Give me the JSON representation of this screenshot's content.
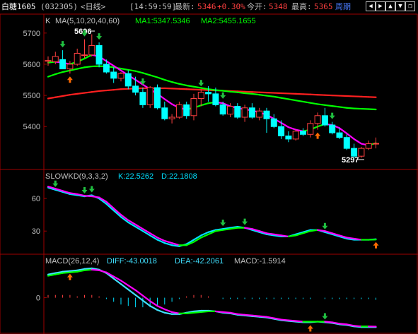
{
  "toolbar": {
    "symbol": "白糖1605",
    "code": "(032305)",
    "period": "<日线>",
    "time": "[14:59:59]",
    "latest_label": "最新:",
    "latest_value": "5346",
    "change": "+0.30%",
    "open_label": "今开:",
    "open_value": "5348",
    "high_label": "最高:",
    "high_value": "5365",
    "cycle_label": "周期",
    "nav_icons": [
      "arrow-left-icon",
      "arrow-right-icon",
      "arrow-up-icon",
      "arrow-down-icon",
      "restore-icon"
    ]
  },
  "chart_data": [
    {
      "type": "candlestick",
      "header": {
        "name": "K",
        "ma_spec": "MA(5,10,20,40,60)",
        "ma1": "MA1:5347.5346",
        "ma2": "MA2:5455.1655"
      },
      "yticks": [
        5700,
        5600,
        5500,
        5400
      ],
      "ylim": [
        5285,
        5720
      ],
      "annotations": {
        "high": "5696",
        "low": "5297"
      },
      "candles": [
        [
          5610,
          5625,
          5595,
          5612
        ],
        [
          5608,
          5640,
          5600,
          5625
        ],
        [
          5615,
          5645,
          5592,
          5585
        ],
        [
          5585,
          5610,
          5570,
          5600
        ],
        [
          5600,
          5650,
          5595,
          5635
        ],
        [
          5630,
          5680,
          5620,
          5630
        ],
        [
          5630,
          5696,
          5625,
          5660
        ],
        [
          5660,
          5670,
          5590,
          5600
        ],
        [
          5600,
          5615,
          5570,
          5575
        ],
        [
          5575,
          5590,
          5540,
          5555
        ],
        [
          5555,
          5575,
          5545,
          5570
        ],
        [
          5570,
          5580,
          5520,
          5530
        ],
        [
          5530,
          5560,
          5500,
          5510
        ],
        [
          5510,
          5525,
          5460,
          5470
        ],
        [
          5470,
          5530,
          5460,
          5525
        ],
        [
          5525,
          5535,
          5455,
          5460
        ],
        [
          5460,
          5480,
          5420,
          5425
        ],
        [
          5425,
          5440,
          5410,
          5430
        ],
        [
          5430,
          5480,
          5425,
          5470
        ],
        [
          5470,
          5480,
          5425,
          5435
        ],
        [
          5435,
          5505,
          5420,
          5490
        ],
        [
          5490,
          5520,
          5465,
          5510
        ],
        [
          5510,
          5530,
          5480,
          5505
        ],
        [
          5505,
          5525,
          5465,
          5470
        ],
        [
          5470,
          5480,
          5435,
          5440
        ],
        [
          5440,
          5475,
          5430,
          5465
        ],
        [
          5465,
          5475,
          5425,
          5430
        ],
        [
          5430,
          5470,
          5415,
          5460
        ],
        [
          5460,
          5475,
          5425,
          5430
        ],
        [
          5430,
          5460,
          5420,
          5450
        ],
        [
          5450,
          5460,
          5380,
          5425
        ],
        [
          5425,
          5440,
          5395,
          5400
        ],
        [
          5400,
          5420,
          5360,
          5370
        ],
        [
          5370,
          5385,
          5350,
          5360
        ],
        [
          5360,
          5390,
          5355,
          5385
        ],
        [
          5385,
          5395,
          5370,
          5375
        ],
        [
          5375,
          5420,
          5365,
          5410
        ],
        [
          5410,
          5445,
          5390,
          5435
        ],
        [
          5435,
          5460,
          5400,
          5405
        ],
        [
          5405,
          5415,
          5375,
          5380
        ],
        [
          5380,
          5395,
          5360,
          5365
        ],
        [
          5365,
          5375,
          5325,
          5330
        ],
        [
          5330,
          5345,
          5297,
          5305
        ],
        [
          5305,
          5335,
          5300,
          5330
        ],
        [
          5330,
          5355,
          5325,
          5345
        ],
        [
          5345,
          5365,
          5330,
          5346
        ]
      ],
      "ma_lines": [
        {
          "name": "MA1",
          "color": "#00ff00",
          "alt_color": "#ff00ff",
          "values": [
            5605,
            5608,
            5605,
            5600,
            5608,
            5618,
            5630,
            5625,
            5610,
            5595,
            5580,
            5565,
            5550,
            5535,
            5520,
            5505,
            5488,
            5472,
            5460,
            5455,
            5460,
            5468,
            5475,
            5478,
            5475,
            5465,
            5460,
            5455,
            5452,
            5445,
            5438,
            5425,
            5412,
            5398,
            5390,
            5385,
            5390,
            5400,
            5408,
            5405,
            5395,
            5378,
            5360,
            5345,
            5340,
            5347
          ]
        },
        {
          "name": "MA2",
          "color": "#00ff00",
          "values": [
            5560,
            5568,
            5575,
            5580,
            5585,
            5590,
            5593,
            5594,
            5593,
            5590,
            5586,
            5582,
            5578,
            5572,
            5565,
            5558,
            5550,
            5543,
            5537,
            5532,
            5528,
            5524,
            5520,
            5517,
            5515,
            5512,
            5510,
            5507,
            5505,
            5502,
            5499,
            5496,
            5492,
            5488,
            5484,
            5480,
            5476,
            5472,
            5469,
            5466,
            5463,
            5460,
            5458,
            5457,
            5456,
            5455
          ]
        },
        {
          "name": "MA-long",
          "color": "#ff2020",
          "values": [
            5490,
            5494,
            5498,
            5502,
            5505,
            5508,
            5511,
            5514,
            5516,
            5518,
            5520,
            5521,
            5522,
            5523,
            5523,
            5523,
            5523,
            5522,
            5521,
            5520,
            5519,
            5518,
            5517,
            5516,
            5515,
            5514,
            5513,
            5512,
            5511,
            5510,
            5509,
            5508,
            5507,
            5506,
            5505,
            5504,
            5503,
            5502,
            5501,
            5500,
            5499,
            5498,
            5497,
            5496,
            5495,
            5494
          ]
        }
      ],
      "signals": [
        {
          "index": 2,
          "dir": "down"
        },
        {
          "index": 3,
          "dir": "up"
        },
        {
          "index": 5,
          "dir": "down"
        },
        {
          "index": 7,
          "dir": "down"
        },
        {
          "index": 13,
          "dir": "down"
        },
        {
          "index": 21,
          "dir": "down"
        },
        {
          "index": 24,
          "dir": "down"
        },
        {
          "index": 37,
          "dir": "up"
        },
        {
          "index": 39,
          "dir": "down"
        }
      ]
    },
    {
      "type": "line",
      "header": {
        "name": "SLOWKD(9,3,3,2)",
        "k": "K:22.5262",
        "d": "D:22.1808"
      },
      "yticks": [
        60,
        30
      ],
      "ylim": [
        10,
        75
      ],
      "series": [
        {
          "name": "K",
          "color": "#00e0ff",
          "values": [
            70,
            68,
            66,
            64,
            63,
            62,
            63,
            60,
            55,
            49,
            43,
            38,
            34,
            30,
            26,
            22,
            19,
            17,
            16,
            18,
            22,
            26,
            29,
            31,
            32,
            33,
            34,
            33,
            31,
            29,
            27,
            26,
            25,
            25,
            27,
            29,
            31,
            31,
            29,
            27,
            25,
            23,
            22,
            22,
            22,
            22.5
          ]
        },
        {
          "name": "D",
          "color": "#00ff00",
          "alt_color": "#ff00ff",
          "values": [
            71,
            69,
            67,
            65,
            64,
            62.5,
            62,
            61,
            57,
            51,
            45,
            40,
            36,
            32,
            28,
            24,
            21,
            19,
            17,
            17,
            20,
            24,
            27,
            30,
            31,
            32,
            33,
            33,
            32,
            30,
            28,
            27,
            26,
            25,
            26,
            28,
            30,
            31,
            30,
            28,
            26,
            24,
            23,
            22,
            22,
            22.2
          ]
        }
      ],
      "signals": [
        {
          "index": 1,
          "dir": "down"
        },
        {
          "index": 5,
          "dir": "down"
        },
        {
          "index": 6,
          "dir": "down"
        },
        {
          "index": 24,
          "dir": "down"
        },
        {
          "index": 27,
          "dir": "down"
        },
        {
          "index": 38,
          "dir": "down"
        },
        {
          "index": 45,
          "dir": "up"
        }
      ]
    },
    {
      "type": "line",
      "header": {
        "name": "MACD(26,12,4)",
        "diff": "DIFF:-43.0018",
        "dea": "DEA:-42.2061",
        "macd": "MACD:-1.5914"
      },
      "yticks": [
        0
      ],
      "ylim": [
        -50,
        45
      ],
      "series": [
        {
          "name": "DIFF",
          "color": "#40e0ff",
          "values": [
            34,
            36,
            38,
            39,
            40,
            42,
            43,
            41,
            36,
            28,
            20,
            12,
            4,
            -4,
            -12,
            -18,
            -22,
            -24,
            -24,
            -22,
            -20,
            -19,
            -19,
            -20,
            -22,
            -23,
            -25,
            -26,
            -27,
            -28,
            -29,
            -31,
            -33,
            -34,
            -35,
            -36,
            -36,
            -35,
            -36,
            -37,
            -39,
            -40,
            -42,
            -43,
            -43,
            -43
          ]
        },
        {
          "name": "DEA",
          "color": "#00ff00",
          "alt_color": "#ff00ff",
          "values": [
            32,
            34,
            36,
            37,
            38,
            40,
            41,
            40,
            37,
            31,
            25,
            18,
            11,
            3,
            -5,
            -12,
            -17,
            -21,
            -23,
            -23,
            -22,
            -21,
            -20,
            -20,
            -21,
            -22,
            -24,
            -25,
            -26,
            -27,
            -28,
            -30,
            -32,
            -33,
            -34,
            -35,
            -35,
            -35,
            -35,
            -36,
            -38,
            -39,
            -41,
            -42,
            -42,
            -42.2
          ]
        }
      ],
      "bars": [
        2,
        2,
        2,
        2,
        1,
        2,
        2,
        1,
        -1,
        -3,
        -5,
        -6,
        -7,
        -7,
        -7,
        -6,
        -5,
        -3,
        -1,
        1,
        2,
        2,
        1,
        0,
        -1,
        -1,
        -1,
        -1,
        -1,
        -1,
        -1,
        -1,
        -1,
        -1,
        -1,
        -1,
        -1,
        0,
        -1,
        -1,
        -1,
        -1,
        -1,
        -1,
        -1,
        -1.6
      ],
      "signals": [
        {
          "index": 3,
          "dir": "up"
        },
        {
          "index": 36,
          "dir": "up"
        },
        {
          "index": 38,
          "dir": "down"
        }
      ]
    }
  ]
}
